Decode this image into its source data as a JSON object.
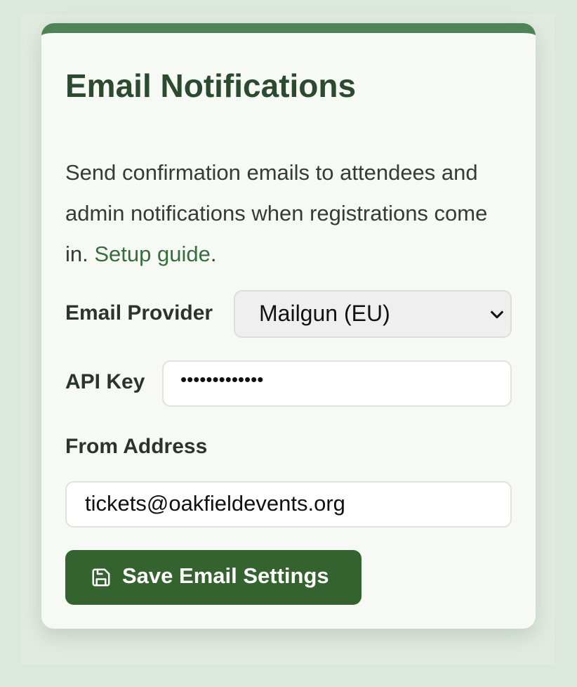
{
  "card": {
    "title": "Email Notifications",
    "description": "Send confirmation emails to attendees and admin notifications when registrations come in. ",
    "guide_link": "Setup guide",
    "guide_suffix": "."
  },
  "fields": {
    "provider": {
      "label": "Email Provider",
      "value": "Mailgun (EU)"
    },
    "api_key": {
      "label": "API Key",
      "value": "•••••••••••••"
    },
    "from_address": {
      "label": "From Address",
      "value": "tickets@oakfieldevents.org"
    }
  },
  "actions": {
    "save_label": "Save Email Settings",
    "save_icon": "save-icon"
  },
  "colors": {
    "accent": "#4e8357",
    "button": "#356330",
    "link": "#386d3e",
    "title": "#2b4a30"
  }
}
